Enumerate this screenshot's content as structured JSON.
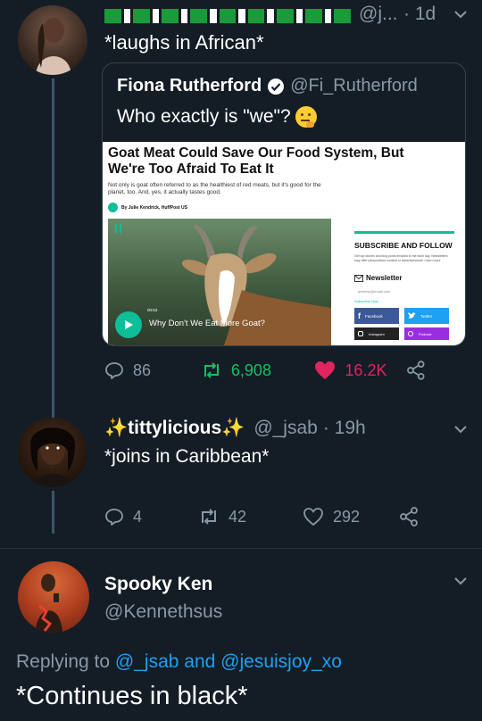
{
  "tweet1": {
    "handle": "@j...",
    "time": "· 1d",
    "text": "*laughs in African*",
    "flag_colors": [
      "#1a9a3a",
      "#ffffff"
    ],
    "quote": {
      "name": "Fiona Rutherford",
      "handle": "@Fi_Rutherford",
      "text": "Who exactly is \"we\"?",
      "emoji": "thinking-face",
      "article": {
        "headline": "Goat Meat Could Save Our Food System, But We're Too Afraid To Eat It",
        "subtitle": "Not only is goat often referred to as the healthiest of red meats, but it's good for the planet, too. And, yes, it actually tastes good.",
        "byline": "By Julie Kendrick, HuffPost US",
        "video_caption": "Why Don't We Eat More Goat?",
        "video_time": "00:53",
        "sidebar_title": "SUBSCRIBE AND FOLLOW",
        "sidebar_text": "Get top stories and blog posts emailed to me each day. Newsletters may offer personalized content or advertisements. Learn more",
        "newsletter_label": "Newsletter",
        "email_placeholder": "address@email.com",
        "subscribe_label": "Subscribe Now →",
        "facebook_label": "Facebook",
        "twitter_label": "Twitter",
        "instagram_label": "Instagram",
        "podcast_label": "Podcast"
      }
    },
    "replies": "86",
    "retweets": "6,908",
    "likes": "16.2K",
    "retweet_color": "#17bf63",
    "like_color": "#e0245e"
  },
  "tweet2": {
    "name": "✨tittylicious✨",
    "handle": "@_jsab",
    "time": "· 19h",
    "text": "*joins in Caribbean*",
    "replies": "4",
    "retweets": "42",
    "likes": "292"
  },
  "tweet3": {
    "name": "Spooky Ken",
    "handle": "@Kennethsus",
    "replying_prefix": "Replying to",
    "mention1": "@_jsab",
    "and": "and",
    "mention2": "@jesuisjoy_xo",
    "text": "*Continues in black*"
  }
}
